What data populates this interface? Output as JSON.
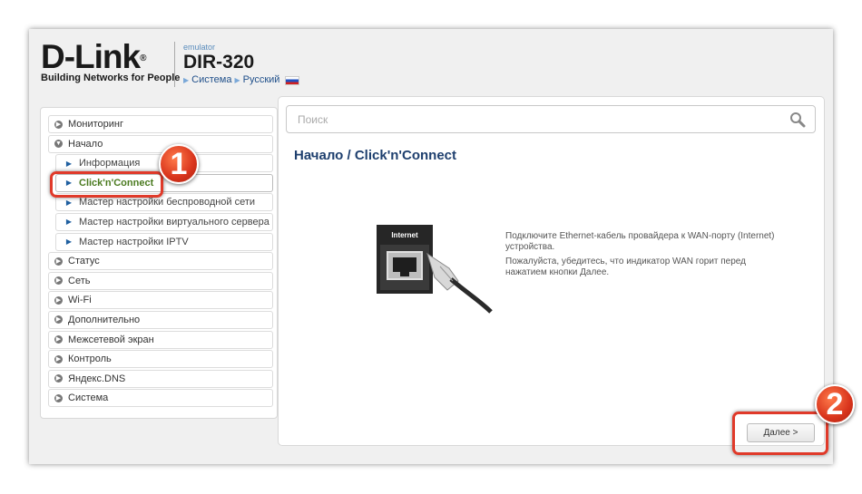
{
  "header": {
    "logo_text": "D-Link",
    "logo_mark": "®",
    "tagline": "Building Networks for People",
    "emulator_label": "emulator",
    "model": "DIR-320",
    "nav_system": "Система",
    "nav_language": "Русский"
  },
  "sidebar": {
    "items": [
      {
        "label": "Мониторинг",
        "level": 0,
        "icon": "chevron-right-icon"
      },
      {
        "label": "Начало",
        "level": 0,
        "icon": "chevron-down-icon"
      },
      {
        "label": "Информация",
        "level": 1,
        "icon": "triangle-right-icon"
      },
      {
        "label": "Click'n'Connect",
        "level": 1,
        "icon": "triangle-right-icon",
        "active": true
      },
      {
        "label": "Мастер настройки беспроводной сети",
        "level": 1,
        "icon": "triangle-right-icon"
      },
      {
        "label": "Мастер настройки виртуального сервера",
        "level": 1,
        "icon": "triangle-right-icon"
      },
      {
        "label": "Мастер настройки IPTV",
        "level": 1,
        "icon": "triangle-right-icon"
      },
      {
        "label": "Статус",
        "level": 0,
        "icon": "chevron-right-icon"
      },
      {
        "label": "Сеть",
        "level": 0,
        "icon": "chevron-right-icon"
      },
      {
        "label": "Wi-Fi",
        "level": 0,
        "icon": "chevron-right-icon"
      },
      {
        "label": "Дополнительно",
        "level": 0,
        "icon": "chevron-right-icon"
      },
      {
        "label": "Межсетевой экран",
        "level": 0,
        "icon": "chevron-right-icon"
      },
      {
        "label": "Контроль",
        "level": 0,
        "icon": "chevron-right-icon"
      },
      {
        "label": "Яндекс.DNS",
        "level": 0,
        "icon": "chevron-right-icon"
      },
      {
        "label": "Система",
        "level": 0,
        "icon": "chevron-right-icon"
      }
    ]
  },
  "main": {
    "search_placeholder": "Поиск",
    "title": "Начало /  Click'n'Connect",
    "port_label": "Internet",
    "desc_line1": "Подключите Ethernet-кабель провайдера к WAN-порту (Internet) устройства.",
    "desc_line2": "Пожалуйста, убедитесь, что индикатор WAN горит перед нажатием кнопки Далее.",
    "next_label": "Далее >"
  },
  "annotations": {
    "badge1": "1",
    "badge2": "2"
  },
  "colors": {
    "accent_title": "#1e3f6e",
    "active_item": "#4a7a1f",
    "highlight": "#e03a2a"
  }
}
